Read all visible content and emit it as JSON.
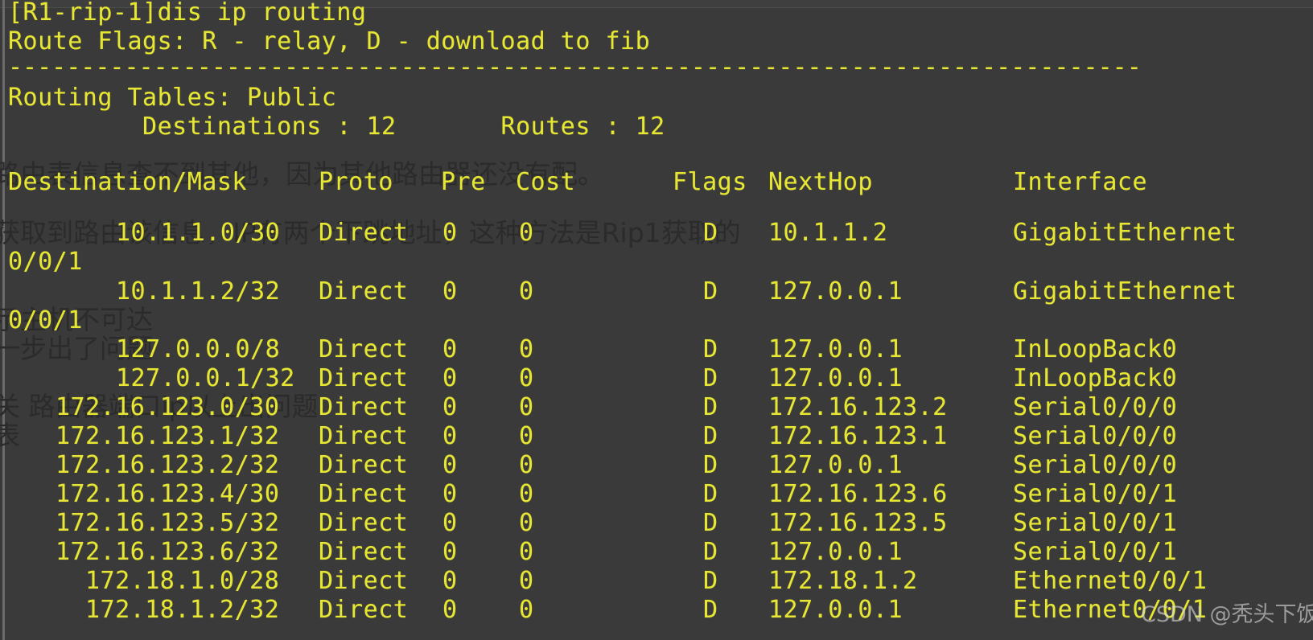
{
  "terminal": {
    "background_color": "#3a3a3a",
    "text_color": "#e6e633",
    "prompt_line": "[R1-rip-1]dis ip routing",
    "flags_line": "Route Flags: R - relay, D - download to fib",
    "separator": "------------------------------------------------------------------------------",
    "tables_line": "Routing Tables: Public",
    "summary_line": "         Destinations : 12       Routes : 12",
    "columns": {
      "destination_mask": "Destination/Mask",
      "proto": "Proto",
      "pre": "Pre",
      "cost": "Cost",
      "flags": "Flags",
      "nexthop": "NextHop",
      "interface": "Interface"
    },
    "rows": [
      {
        "destination": "10.1.1.0/30",
        "proto": "Direct",
        "pre": "0",
        "cost": "0",
        "flags": "D",
        "nexthop": "10.1.1.2",
        "interface": "GigabitEthernet",
        "interface_cont": "0/0/1"
      },
      {
        "destination": "10.1.1.2/32",
        "proto": "Direct",
        "pre": "0",
        "cost": "0",
        "flags": "D",
        "nexthop": "127.0.0.1",
        "interface": "GigabitEthernet",
        "interface_cont": "0/0/1"
      },
      {
        "destination": "127.0.0.0/8",
        "proto": "Direct",
        "pre": "0",
        "cost": "0",
        "flags": "D",
        "nexthop": "127.0.0.1",
        "interface": "InLoopBack0",
        "interface_cont": ""
      },
      {
        "destination": "127.0.0.1/32",
        "proto": "Direct",
        "pre": "0",
        "cost": "0",
        "flags": "D",
        "nexthop": "127.0.0.1",
        "interface": "InLoopBack0",
        "interface_cont": ""
      },
      {
        "destination": "172.16.123.0/30",
        "proto": "Direct",
        "pre": "0",
        "cost": "0",
        "flags": "D",
        "nexthop": "172.16.123.2",
        "interface": "Serial0/0/0",
        "interface_cont": ""
      },
      {
        "destination": "172.16.123.1/32",
        "proto": "Direct",
        "pre": "0",
        "cost": "0",
        "flags": "D",
        "nexthop": "172.16.123.1",
        "interface": "Serial0/0/0",
        "interface_cont": ""
      },
      {
        "destination": "172.16.123.2/32",
        "proto": "Direct",
        "pre": "0",
        "cost": "0",
        "flags": "D",
        "nexthop": "127.0.0.1",
        "interface": "Serial0/0/0",
        "interface_cont": ""
      },
      {
        "destination": "172.16.123.4/30",
        "proto": "Direct",
        "pre": "0",
        "cost": "0",
        "flags": "D",
        "nexthop": "172.16.123.6",
        "interface": "Serial0/0/1",
        "interface_cont": ""
      },
      {
        "destination": "172.16.123.5/32",
        "proto": "Direct",
        "pre": "0",
        "cost": "0",
        "flags": "D",
        "nexthop": "172.16.123.5",
        "interface": "Serial0/0/1",
        "interface_cont": ""
      },
      {
        "destination": "172.16.123.6/32",
        "proto": "Direct",
        "pre": "0",
        "cost": "0",
        "flags": "D",
        "nexthop": "127.0.0.1",
        "interface": "Serial0/0/1",
        "interface_cont": ""
      },
      {
        "destination": "172.18.1.0/28",
        "proto": "Direct",
        "pre": "0",
        "cost": "0",
        "flags": "D",
        "nexthop": "172.18.1.2",
        "interface": "Ethernet0/0/1",
        "interface_cont": ""
      },
      {
        "destination": "172.18.1.2/32",
        "proto": "Direct",
        "pre": "0",
        "cost": "0",
        "flags": "D",
        "nexthop": "127.0.0.1",
        "interface": "Ethernet0/0/1",
        "interface_cont": ""
      }
    ]
  },
  "annotations": {
    "color": "#2b2b2b",
    "items": [
      {
        "text": "路由表信息查不到其他，因为其他路由器还没有配。"
      },
      {
        "text": "获取到路由该信息，IP有两个下跳地址，这种方法是Rip1获取的"
      },
      {
        "text": "示主机不可达"
      },
      {
        "text": "一步出了问题"
      },
      {
        "text": "关 路由器端口ip以上出问题"
      },
      {
        "text": "表"
      }
    ]
  },
  "watermark": {
    "text": "CSDN @秃头下饭菜",
    "color": "#d7d7d7"
  }
}
